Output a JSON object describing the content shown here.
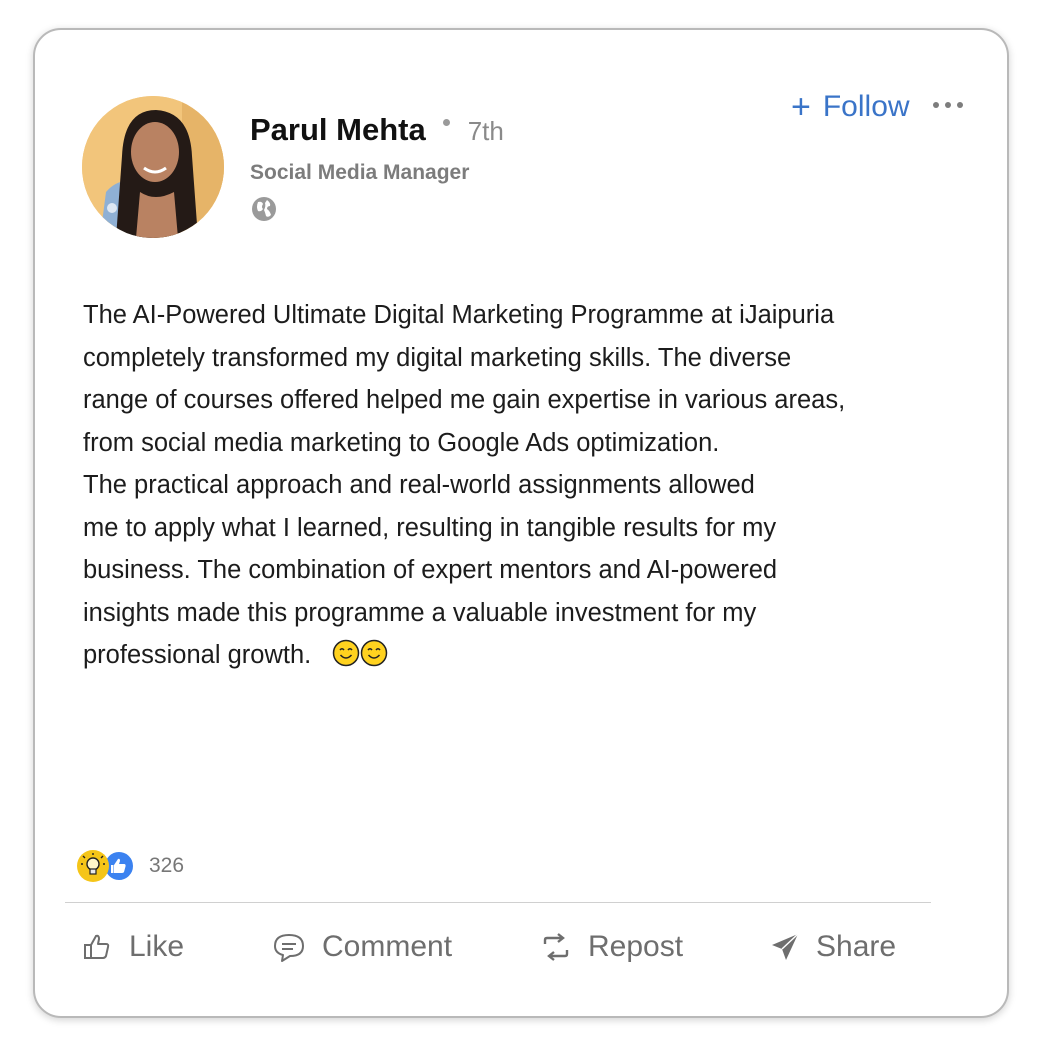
{
  "post": {
    "author": {
      "name": "Parul Mehta",
      "connection_degree": "7th",
      "headline": "Social Media Manager"
    },
    "follow_label": "Follow",
    "paragraphs": [
      "The AI-Powered Ultimate Digital Marketing Programme at iJaipuria",
      "completely transformed my digital marketing skills. The diverse",
      "range of courses offered helped me gain expertise in various areas,",
      "from social media marketing to Google Ads optimization.",
      "The practical approach and real-world assignments allowed",
      "me to apply what I learned, resulting in tangible results for my",
      "business. The combination of expert mentors and AI-powered",
      "insights made this programme a valuable investment  for my",
      "professional growth."
    ],
    "reaction_count": "326",
    "actions": {
      "like": "Like",
      "comment": "Comment",
      "repost": "Repost",
      "share": "Share"
    }
  },
  "icons": {
    "visibility": "globe-icon",
    "reactions": [
      "insightful-icon",
      "like-reaction-icon"
    ],
    "emoji": [
      "smiling-face-icon",
      "smiling-face-icon"
    ]
  },
  "colors": {
    "accent": "#3a74c8",
    "like_reaction": "#3b82f0",
    "insightful_reaction": "#f5c518"
  }
}
